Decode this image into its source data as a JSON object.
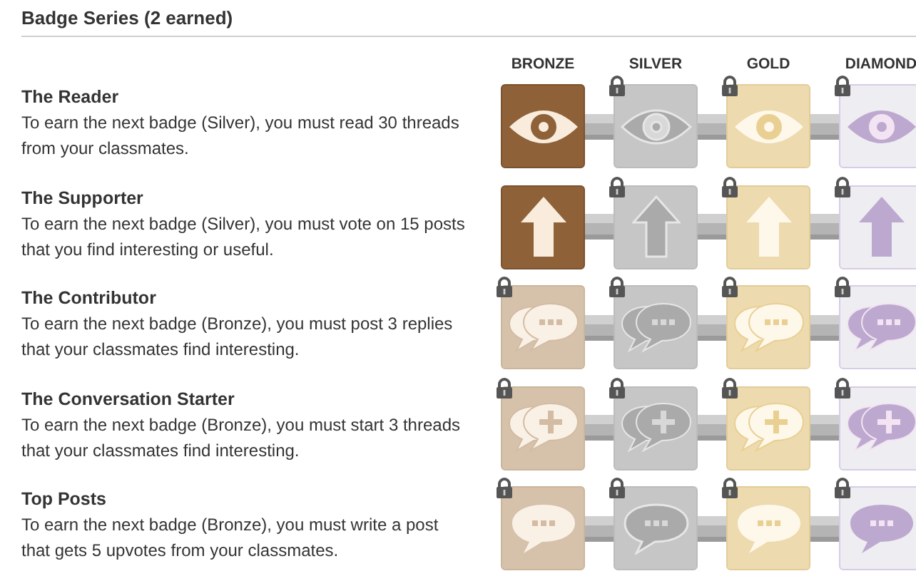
{
  "section": {
    "title": "Badge Series (2 earned)"
  },
  "tiers": [
    {
      "label": "BRONZE",
      "kind": "bronze"
    },
    {
      "label": "SILVER",
      "kind": "silver"
    },
    {
      "label": "GOLD",
      "kind": "gold"
    },
    {
      "label": "DIAMOND",
      "kind": "diamond"
    }
  ],
  "series": [
    {
      "name": "The Reader",
      "description": "To earn the next badge (Silver), you must read 30 threads from your classmates.",
      "kind": "eye",
      "badges": [
        {
          "earned": true
        },
        {
          "earned": false
        },
        {
          "earned": false
        },
        {
          "earned": false
        }
      ]
    },
    {
      "name": "The Supporter",
      "description": "To earn the next badge (Silver), you must vote on 15 posts that you find interesting or useful.",
      "kind": "arrow",
      "badges": [
        {
          "earned": true
        },
        {
          "earned": false
        },
        {
          "earned": false
        },
        {
          "earned": false
        }
      ]
    },
    {
      "name": "The Contributor",
      "description": "To earn the next badge (Bronze), you must post 3 replies that your classmates find interesting.",
      "kind": "chats",
      "badges": [
        {
          "earned": false
        },
        {
          "earned": false
        },
        {
          "earned": false
        },
        {
          "earned": false
        }
      ]
    },
    {
      "name": "The Conversation Starter",
      "description": "To earn the next badge (Bronze), you must start 3 threads that your classmates find interesting.",
      "kind": "chats-plus",
      "badges": [
        {
          "earned": false
        },
        {
          "earned": false
        },
        {
          "earned": false
        },
        {
          "earned": false
        }
      ]
    },
    {
      "name": "Top Posts",
      "description": "To earn the next badge (Bronze), you must write a post that gets 5 upvotes from your classmates.",
      "kind": "chat",
      "badges": [
        {
          "earned": false
        },
        {
          "earned": false
        },
        {
          "earned": false
        },
        {
          "earned": false
        }
      ]
    }
  ]
}
